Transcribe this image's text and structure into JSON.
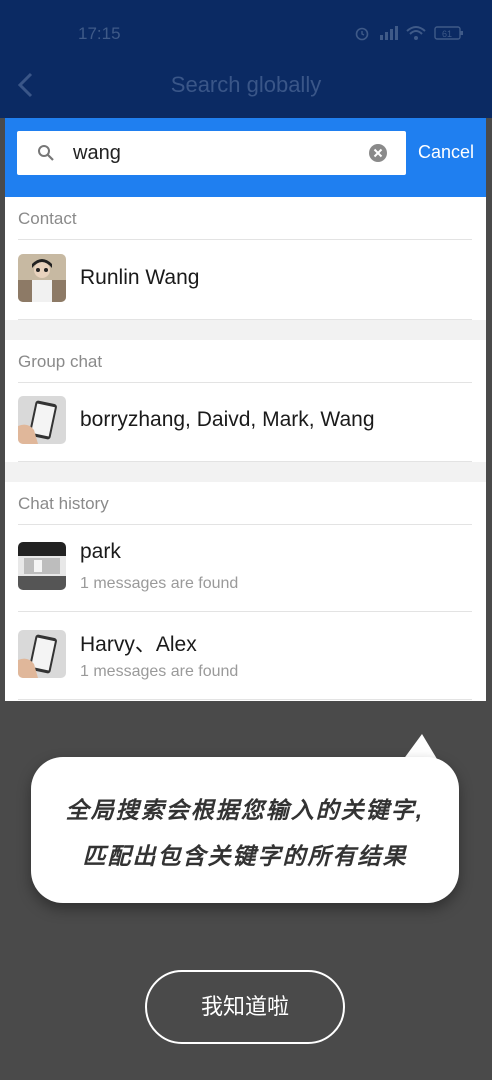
{
  "status_bar": {
    "time": "17:15",
    "battery": "61"
  },
  "header": {
    "title": "Search globally"
  },
  "search": {
    "value": "wang",
    "cancel_label": "Cancel"
  },
  "sections": {
    "contact": {
      "header": "Contact",
      "items": [
        {
          "name": "Runlin Wang"
        }
      ]
    },
    "group_chat": {
      "header": "Group chat",
      "items": [
        {
          "name": "borryzhang, Daivd, Mark, Wang"
        }
      ]
    },
    "chat_history": {
      "header": "Chat history",
      "items": [
        {
          "name": "park",
          "subtitle": "1 messages are found"
        },
        {
          "name": "Harvy、Alex",
          "subtitle": "1 messages are found"
        }
      ]
    }
  },
  "tooltip": {
    "line1": "全局搜索会根据您输入的关键字,",
    "line2": "匹配出包含关键字的所有结果"
  },
  "got_it_label": "我知道啦",
  "colors": {
    "accent": "#1f7ff0",
    "overlay": "#4a4a4a",
    "header_bg": "#0b2a63"
  }
}
